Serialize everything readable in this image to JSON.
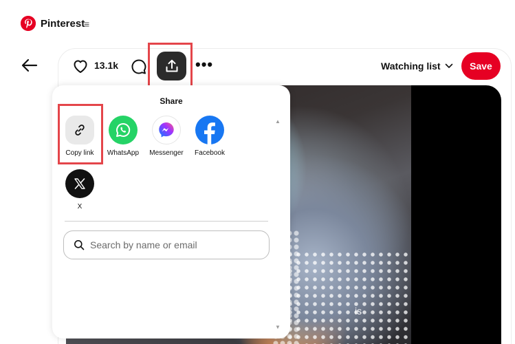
{
  "header": {
    "brand": "Pinterest",
    "menu_glyph": "≡",
    "logo_icon": "pinterest-logo-icon",
    "brand_color": "#e60023"
  },
  "pin": {
    "back_icon": "arrow-left-icon",
    "like_icon": "heart-icon",
    "like_count": "13.1k",
    "comment_icon": "comment-bubble-icon",
    "share_icon": "upload-share-icon",
    "more_label": "•••",
    "board_select": "Watching list",
    "board_select_icon": "chevron-down-icon",
    "save_label": "Save",
    "video_caption": "is"
  },
  "share": {
    "title": "Share",
    "options": [
      {
        "label": "Copy link",
        "icon": "link-icon",
        "color": "#e9e9e9"
      },
      {
        "label": "WhatsApp",
        "icon": "whatsapp-icon",
        "color": "#25d366"
      },
      {
        "label": "Messenger",
        "icon": "messenger-icon",
        "color": "#ffffff"
      },
      {
        "label": "Facebook",
        "icon": "facebook-icon",
        "color": "#1877f2"
      },
      {
        "label": "X",
        "icon": "x-icon",
        "color": "#111111"
      }
    ],
    "search": {
      "placeholder": "Search by name or email",
      "value": "",
      "icon": "search-icon"
    },
    "scroll_up_glyph": "▲",
    "scroll_down_glyph": "▼"
  },
  "annotation_color": "#e4454a"
}
